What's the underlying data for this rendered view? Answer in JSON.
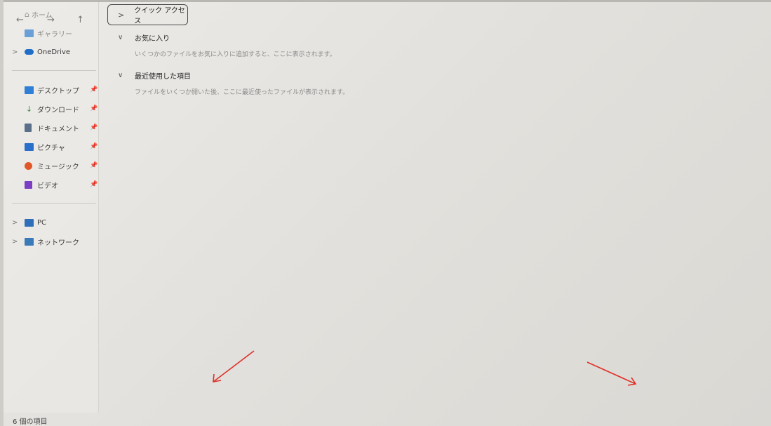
{
  "sidebar": {
    "home_label": "ホーム",
    "gallery_label": "ギャラリー",
    "onedrive_label": "OneDrive",
    "pinned": [
      {
        "label": "デスクトップ",
        "icon": "desktop-icon",
        "color": "#2f7fd6"
      },
      {
        "label": "ダウンロード",
        "icon": "download-icon",
        "color": "#3a8a4a"
      },
      {
        "label": "ドキュメント",
        "icon": "document-icon",
        "color": "#5b6f8a"
      },
      {
        "label": "ピクチャ",
        "icon": "pictures-icon",
        "color": "#2a6fc9"
      },
      {
        "label": "ミュージック",
        "icon": "music-icon",
        "color": "#e0582a"
      },
      {
        "label": "ビデオ",
        "icon": "video-icon",
        "color": "#7b3fc4"
      }
    ],
    "pin_glyph": "📌",
    "pc_label": "PC",
    "network_label": "ネットワーク"
  },
  "main": {
    "quick_access_label": "クイック アクセス",
    "favorites_heading": "お気に入り",
    "favorites_desc": "いくつかのファイルをお気に入りに追加すると、ここに表示されます。",
    "recent_heading": "最近使用した項目",
    "recent_desc": "ファイルをいくつか開いた後、ここに最近使ったファイルが表示されます。"
  },
  "status": {
    "item_count": "6 個の項目"
  },
  "colors": {
    "accent": "#2f7fd6",
    "annotation_arrow": "#e0302a"
  }
}
